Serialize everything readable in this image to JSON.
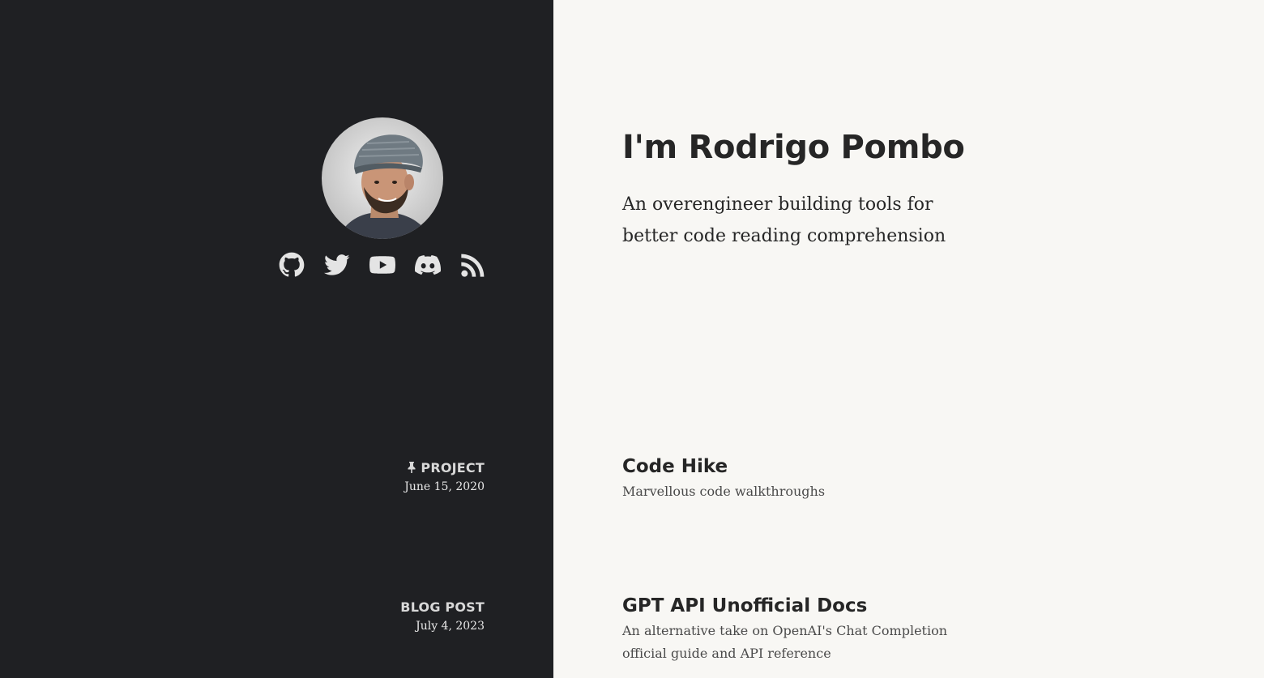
{
  "profile": {
    "name_heading": "I'm Rodrigo Pombo",
    "tagline": "An overengineer building tools for better code reading comprehension",
    "avatar_alt": "Rodrigo Pombo"
  },
  "social": [
    {
      "icon": "github-icon",
      "label": "GitHub"
    },
    {
      "icon": "twitter-icon",
      "label": "Twitter"
    },
    {
      "icon": "youtube-icon",
      "label": "YouTube"
    },
    {
      "icon": "discord-icon",
      "label": "Discord"
    },
    {
      "icon": "rss-icon",
      "label": "RSS"
    }
  ],
  "entries": [
    {
      "kind": "PROJECT",
      "pinned": true,
      "date": "June 15, 2020",
      "title": "Code Hike",
      "description": "Marvellous code walkthroughs"
    },
    {
      "kind": "BLOG POST",
      "pinned": false,
      "date": "July 4, 2023",
      "title": "GPT API Unofficial Docs",
      "description": "An alternative take on OpenAI's Chat Completion official guide and API reference"
    }
  ],
  "colors": {
    "sidebar_bg": "#1f2023",
    "content_bg": "#f8f7f4",
    "heading": "#262626",
    "muted_text": "#4a4a4a",
    "icon": "#e4e4e4"
  }
}
